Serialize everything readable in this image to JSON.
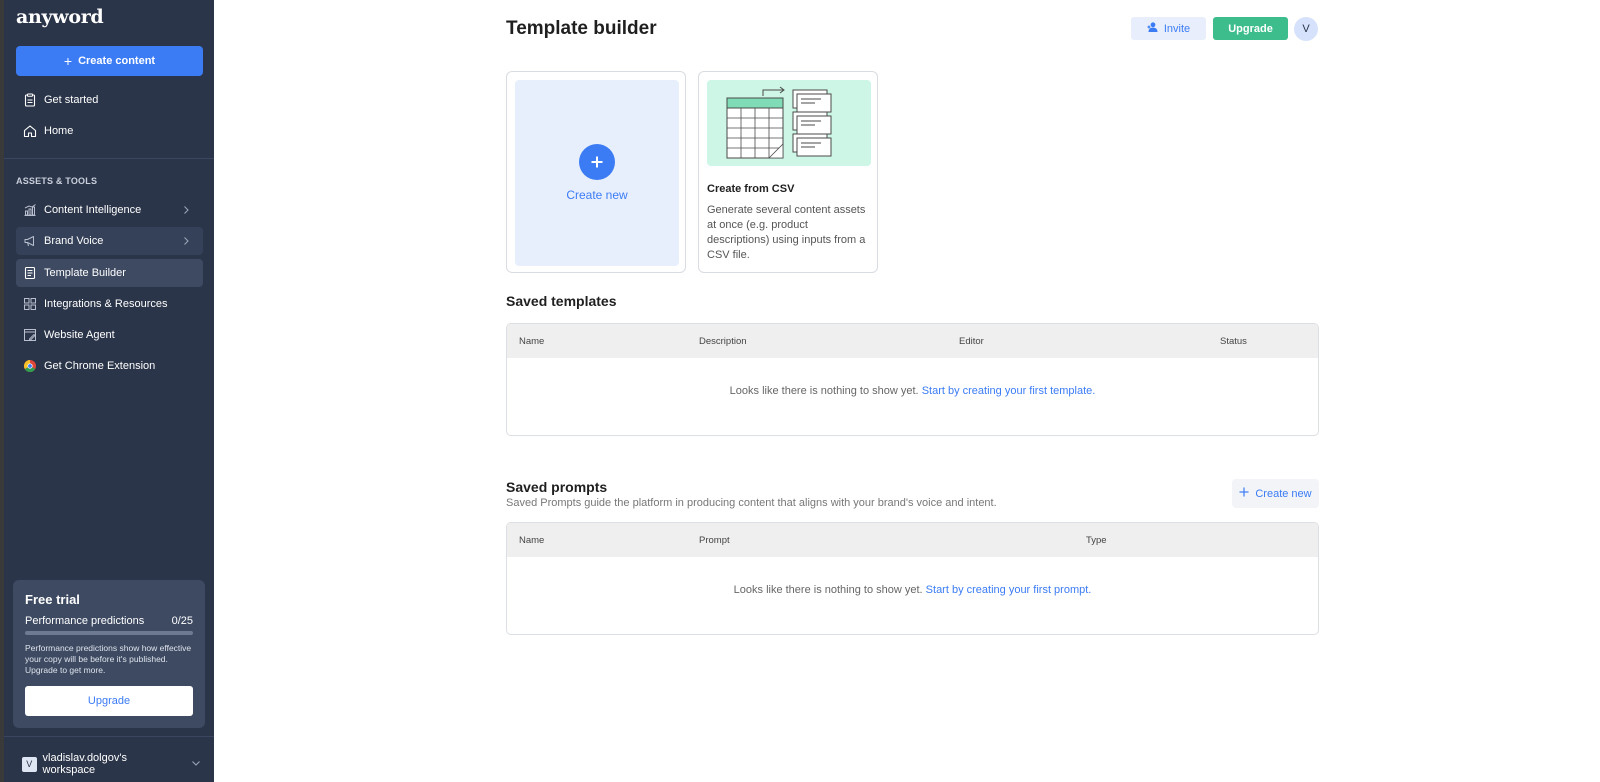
{
  "sidebar": {
    "logo": "anyword",
    "create_button": "Create content",
    "top_items": [
      {
        "label": "Get started"
      },
      {
        "label": "Home"
      }
    ],
    "section_label": "ASSETS & TOOLS",
    "tool_items": [
      {
        "label": "Content Intelligence"
      },
      {
        "label": "Brand Voice"
      },
      {
        "label": "Template Builder"
      },
      {
        "label": "Integrations & Resources"
      },
      {
        "label": "Website Agent"
      },
      {
        "label": "Get Chrome Extension"
      }
    ],
    "trial": {
      "title": "Free trial",
      "metric_label": "Performance predictions",
      "metric_value": "0/25",
      "progress_fraction": 0,
      "description": "Performance predictions show how effective your copy will be before it's published. Upgrade to get more.",
      "upgrade_label": "Upgrade"
    },
    "workspace": {
      "avatar_letter": "V",
      "name": "vladislav.dolgov's workspace"
    }
  },
  "header": {
    "title": "Template builder",
    "invite_label": "Invite",
    "upgrade_label": "Upgrade",
    "avatar_letter": "V"
  },
  "cards": {
    "create_new_label": "Create new",
    "csv_title": "Create from CSV",
    "csv_description": "Generate several content assets at once (e.g. product descriptions) using inputs from a CSV file."
  },
  "saved_templates": {
    "title": "Saved templates",
    "columns": [
      "Name",
      "Description",
      "Editor",
      "Status"
    ],
    "empty_text": "Looks like there is nothing to show yet.",
    "empty_link": "Start by creating your first template."
  },
  "saved_prompts": {
    "title": "Saved prompts",
    "subtitle": "Saved Prompts guide the platform in producing content that aligns with your brand's voice and intent.",
    "create_label": "Create new",
    "columns": [
      "Name",
      "Prompt",
      "Type"
    ],
    "empty_text": "Looks like there is nothing to show yet.",
    "empty_link": "Start by creating your first prompt."
  },
  "colors": {
    "sidebar_bg": "#2b3549",
    "accent": "#3b7cf5",
    "upgrade_green": "#3dbd8c",
    "csv_illustration_bg": "#cdf6e6"
  },
  "icons": {
    "get_started": "clipboard-icon",
    "home": "home-icon",
    "content_intelligence": "chart-icon",
    "brand_voice": "megaphone-icon",
    "template_builder": "document-icon",
    "integrations": "grid-icon",
    "website_agent": "edit-page-icon",
    "chrome": "chrome-icon"
  }
}
